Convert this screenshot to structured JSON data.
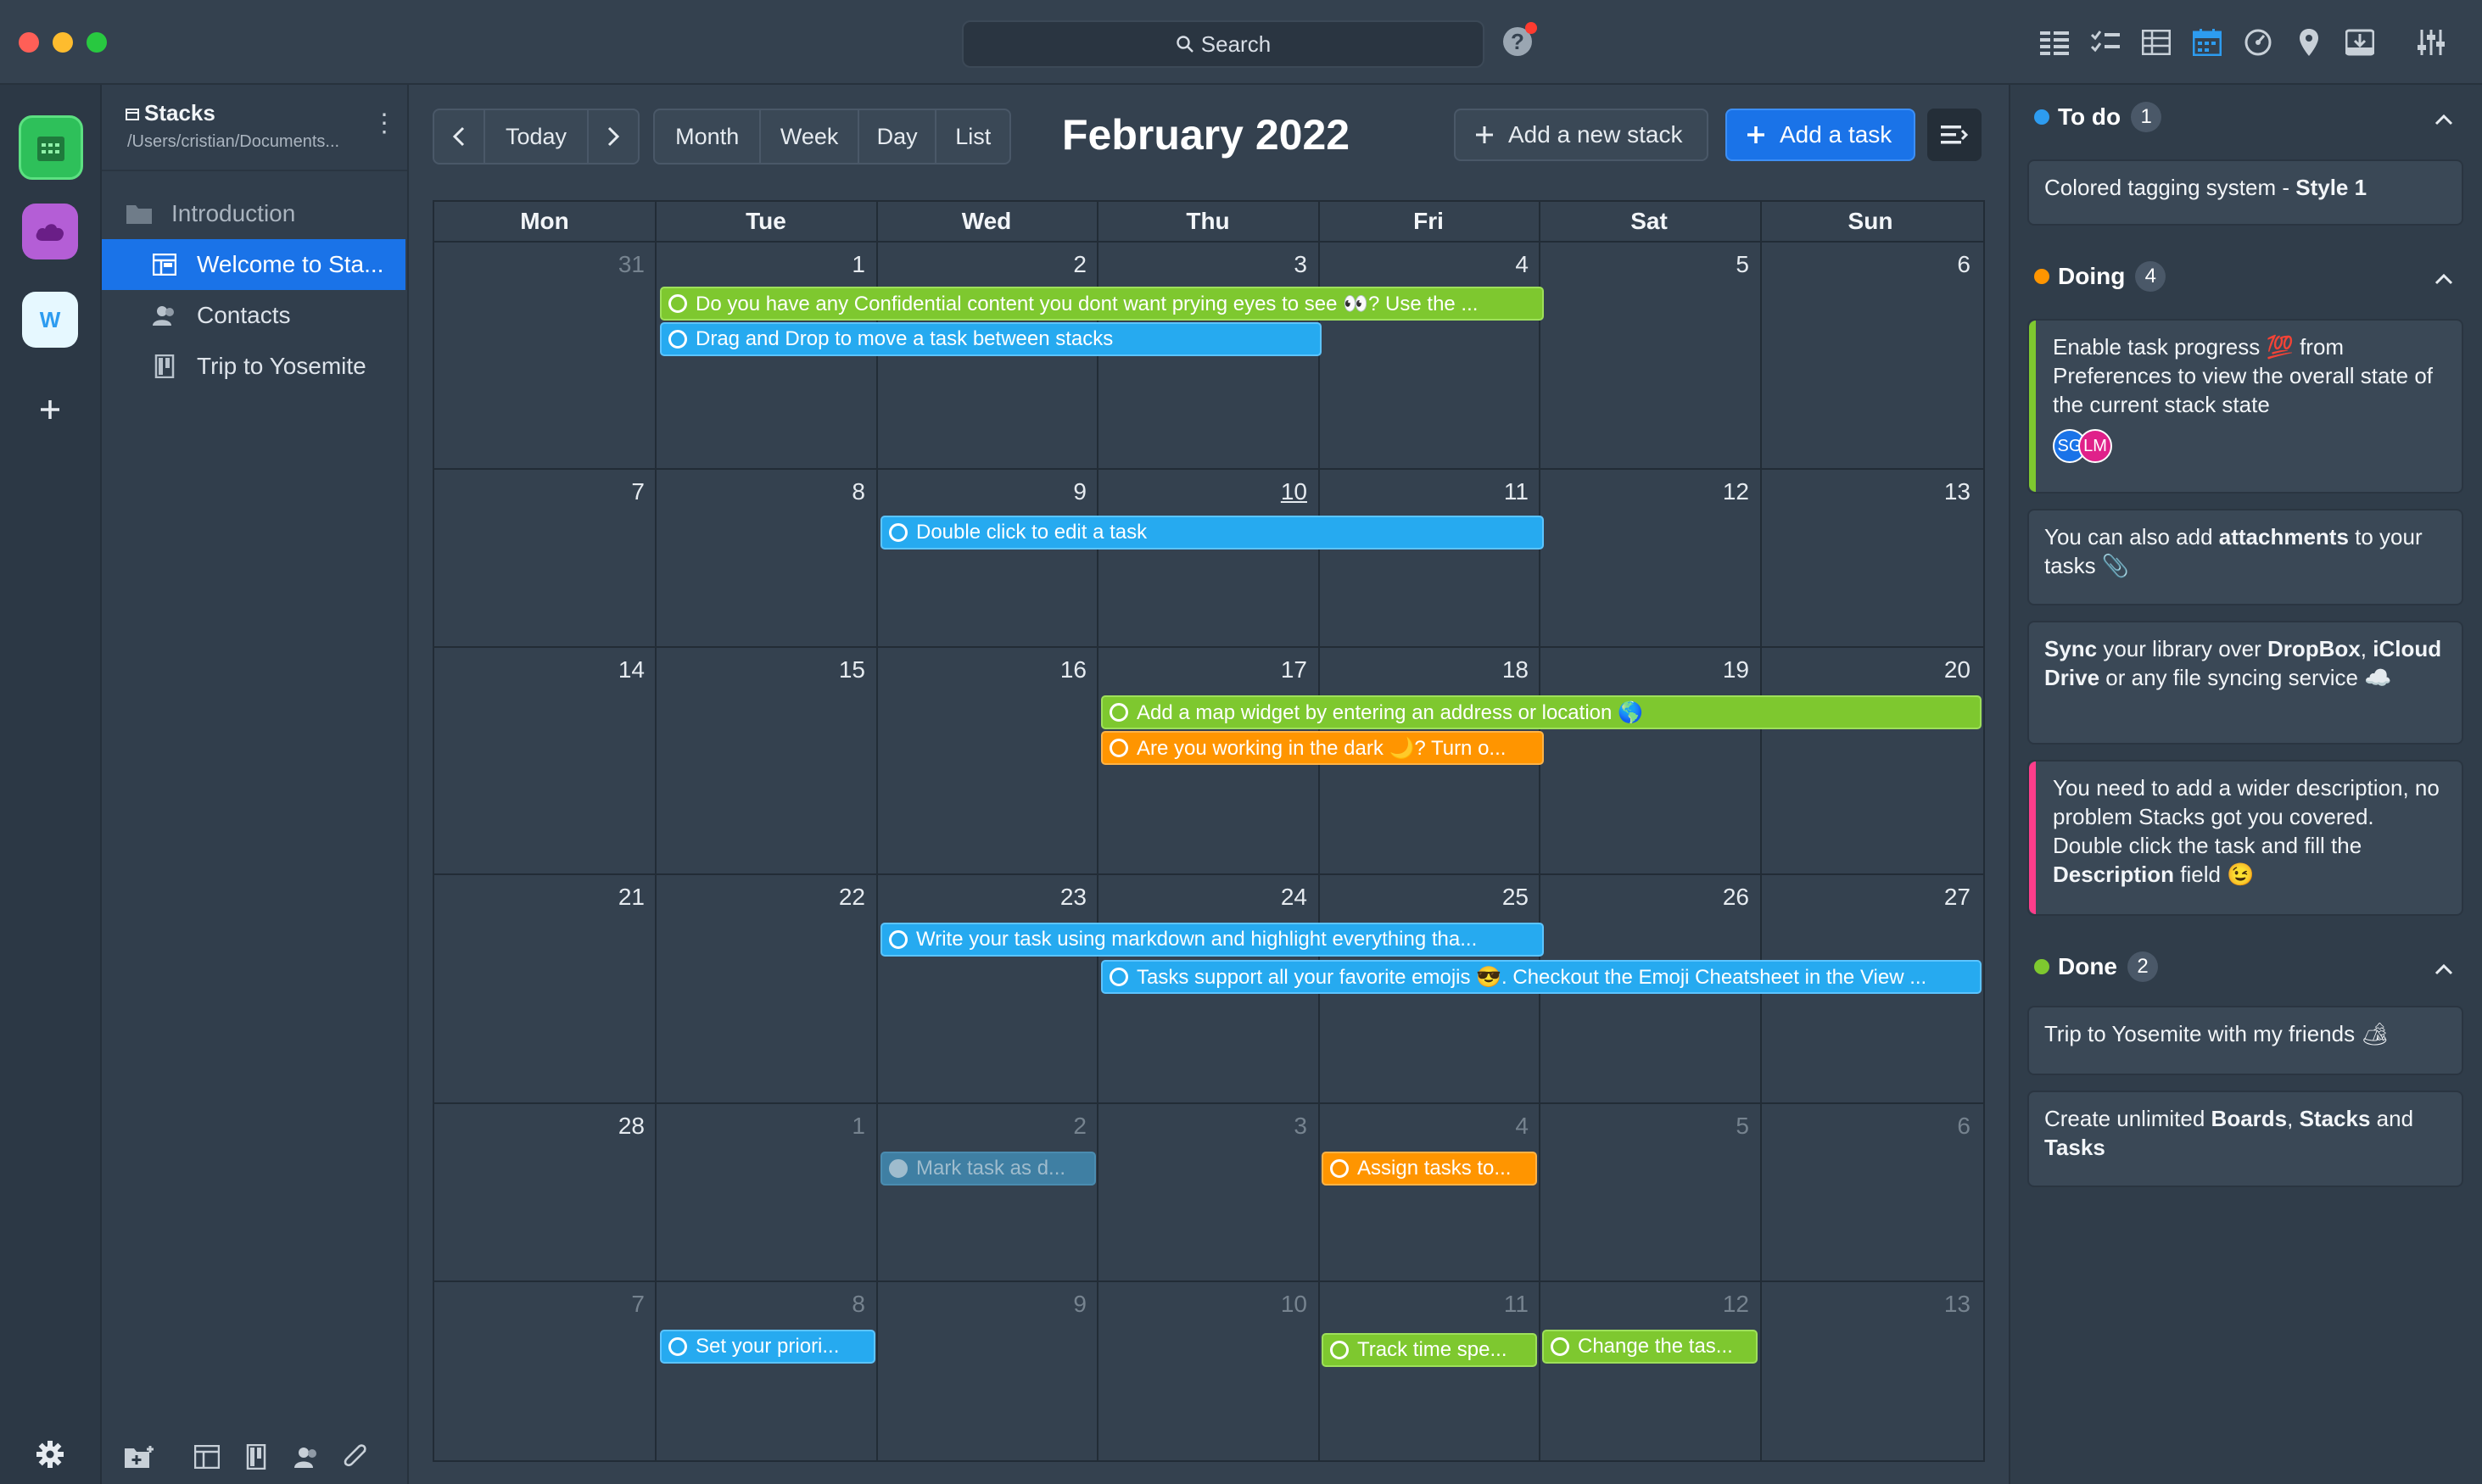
{
  "window": {
    "search_placeholder": "Search",
    "help_label": "?"
  },
  "view_icons": [
    "list-view-icon",
    "checklist-view-icon",
    "table-view-icon",
    "calendar-view-icon",
    "dashboard-view-icon",
    "map-view-icon",
    "archive-view-icon",
    "settings-sliders-icon"
  ],
  "apps": [
    {
      "name": "calendar-app-icon",
      "color": "#4cd964"
    },
    {
      "name": "cloud-app-icon",
      "color": "#b66ad4"
    },
    {
      "name": "w-app-icon",
      "label": "W",
      "color": "#5ad2f4"
    }
  ],
  "sidebar": {
    "title": "Stacks",
    "path": "/Users/cristian/Documents...",
    "items": [
      {
        "label": "Introduction",
        "icon": "folder-icon"
      },
      {
        "label": "Welcome to Sta...",
        "icon": "board-icon"
      },
      {
        "label": "Contacts",
        "icon": "contacts-icon"
      },
      {
        "label": "Trip to Yosemite",
        "icon": "stack-icon"
      }
    ]
  },
  "toolbar": {
    "today": "Today",
    "views": [
      "Month",
      "Week",
      "Day",
      "List"
    ],
    "month_title": "February 2022",
    "add_stack": "Add a new stack",
    "add_task": "Add a task"
  },
  "calendar": {
    "weekdays": [
      "Mon",
      "Tue",
      "Wed",
      "Thu",
      "Fri",
      "Sat",
      "Sun"
    ],
    "weeks": [
      [
        "31",
        "1",
        "2",
        "3",
        "4",
        "5",
        "6"
      ],
      [
        "7",
        "8",
        "9",
        "10",
        "11",
        "12",
        "13"
      ],
      [
        "14",
        "15",
        "16",
        "17",
        "18",
        "19",
        "20"
      ],
      [
        "21",
        "22",
        "23",
        "24",
        "25",
        "26",
        "27"
      ],
      [
        "28",
        "1",
        "2",
        "3",
        "4",
        "5",
        "6"
      ],
      [
        "7",
        "8",
        "9",
        "10",
        "11",
        "12",
        "13"
      ]
    ],
    "events": {
      "e1": "Do you have any Confidential content you dont want prying eyes to see 👀? Use the ...",
      "e2": "Drag and Drop to move a task between stacks",
      "e3": "Double click to edit a task",
      "e4": "Add a map widget by entering an address or location 🌎",
      "e5": "Are you working in the dark 🌙? Turn o...",
      "e6": "Write your task using markdown and highlight everything tha...",
      "e7": "Tasks support all your favorite emojis 😎. Checkout the Emoji Cheatsheet in the View ...",
      "e8": "Mark task as d...",
      "e9": "Assign tasks to...",
      "e10": "Set your priori...",
      "e11": "Track time spe...",
      "e12": "Change the tas..."
    }
  },
  "panel": {
    "todo": {
      "label": "To do",
      "count": "1",
      "color": "#2d9cf0"
    },
    "doing": {
      "label": "Doing",
      "count": "4",
      "color": "#ff9500"
    },
    "done": {
      "label": "Done",
      "count": "2",
      "color": "#7ec82f"
    },
    "todo_cards": [
      "Colored tagging system - Style 1"
    ],
    "doing_cards": [
      "Enable task progress 💯 from Preferences to view the overall state of the current stack state",
      "You can also add attachments to your tasks 📎",
      "Sync your library over DropBox, iCloud Drive or any file syncing service ☁️",
      "You need to add a wider description, no problem Stacks got you covered. Double click the task and fill the Description field 😉"
    ],
    "done_cards": [
      "Trip to Yosemite with my friends 🏕",
      "Create unlimited Boards, Stacks and Tasks"
    ],
    "avatars": [
      "SG",
      "LM"
    ]
  }
}
